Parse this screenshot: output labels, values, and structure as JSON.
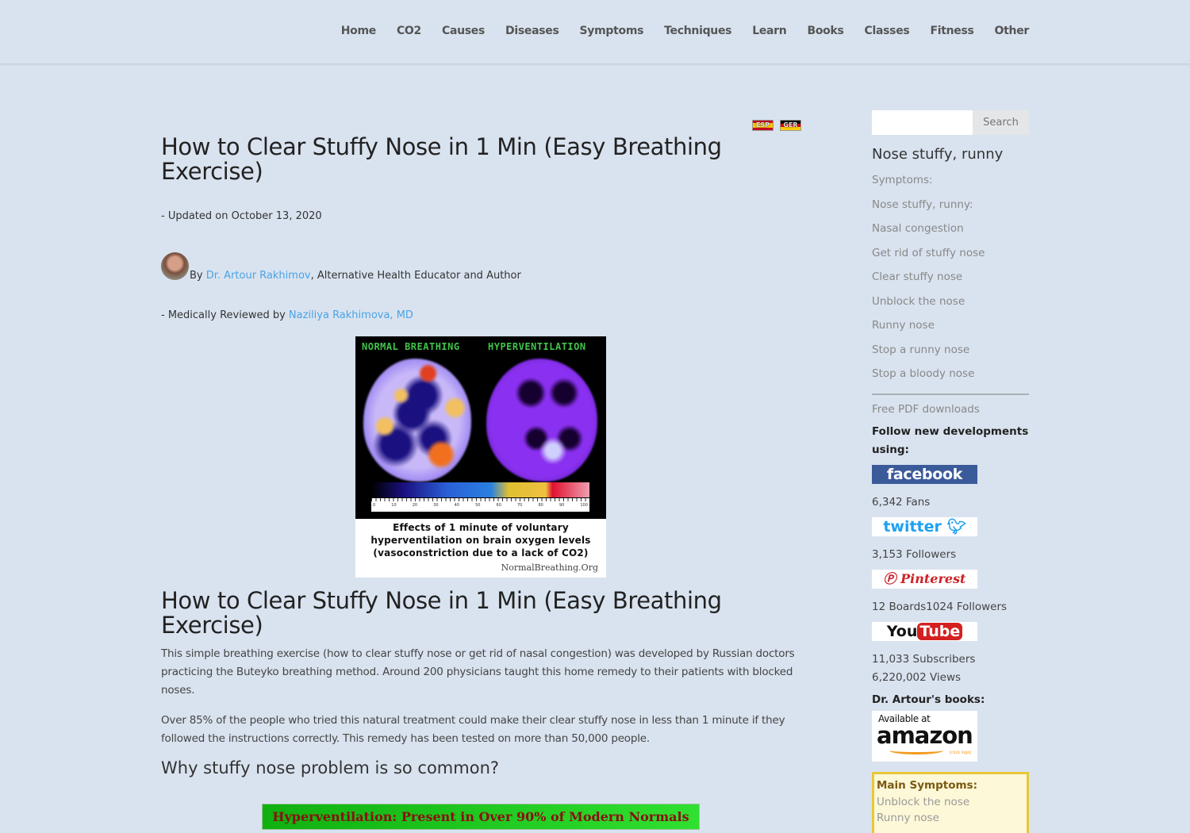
{
  "nav": {
    "items": [
      "Home",
      "CO2",
      "Causes",
      "Diseases",
      "Symptoms",
      "Techniques",
      "Learn",
      "Books",
      "Classes",
      "Fitness",
      "Other"
    ]
  },
  "flags": {
    "esp": "ESP",
    "ger": "GER"
  },
  "article": {
    "title": "How to Clear Stuffy Nose in 1 Min (Easy Breathing Exercise)",
    "updated": "- Updated on October 13, 2020",
    "byline_prefix": "By ",
    "author": "Dr. Artour Rakhimov",
    "author_suffix": ", Alternative Health Educator and Author",
    "reviewed_prefix": "- Medically Reviewed by ",
    "reviewer": "Naziliya Rakhimova, MD",
    "figure": {
      "label_left": "NORMAL BREATHING",
      "label_right": "HYPERVENTILATION",
      "scale_ticks": [
        "0",
        "10",
        "20",
        "30",
        "40",
        "50",
        "60",
        "70",
        "80",
        "90",
        "100"
      ],
      "caption_line1": "Effects of 1 minute of voluntary",
      "caption_line2": "hyperventilation on brain oxygen levels",
      "caption_line3": "(vasoconstriction due to a lack of CO2)",
      "source": "NormalBreathing.Org"
    },
    "heading2": "How to Clear Stuffy Nose in 1 Min (Easy Breathing Exercise)",
    "paragraph1": "This simple breathing exercise (how to clear stuffy nose or get rid of nasal congestion) was developed by Russian doctors practicing the Buteyko breathing method. Around 200 physicians taught this home remedy to their patients with blocked noses.",
    "paragraph2": "Over 85% of the people who tried this natural treatment could make their clear stuffy nose in less than 1 minute if they followed the instructions correctly. This remedy has been tested on more than 50,000 people.",
    "subheading": "Why stuffy nose problem is so common?",
    "banner": "Hyperventilation: Present in Over 90% of Modern Normals"
  },
  "sidebar": {
    "search_placeholder": "",
    "search_button": "Search",
    "title": "Nose stuffy, runny",
    "links": [
      "Symptoms:",
      "Nose stuffy, runny:",
      "Nasal congestion",
      "Get rid of stuffy nose",
      "Clear stuffy nose",
      "Unblock the nose",
      "Runny nose",
      "Stop a runny nose",
      "Stop a bloody nose"
    ],
    "pdf_link": "Free PDF downloads",
    "follow_label": "Follow new developments using:",
    "facebook": "facebook",
    "facebook_stat": "6,342 Fans",
    "twitter": "twitter",
    "twitter_stat": "3,153 Followers",
    "pinterest": "Pinterest",
    "pinterest_stat": "12 Boards1024 Followers",
    "youtube_you": "You",
    "youtube_tube": "Tube",
    "youtube_stat1": "11,033 Subscribers",
    "youtube_stat2": "6,220,002 Views",
    "books_label": "Dr. Artour's books:",
    "amazon_avail": "Available at",
    "amazon_word": "amazon",
    "amazon_click": "[click logo]",
    "main_symptoms": {
      "title": "Main Symptoms:",
      "links": [
        "Unblock the nose",
        "Runny nose"
      ]
    }
  },
  "colors": {
    "background": "#d9e3ef",
    "link": "#4aa3e6",
    "facebook": "#3b5a9a",
    "banner_text": "#8a1010",
    "banner_green": "#20c820"
  }
}
